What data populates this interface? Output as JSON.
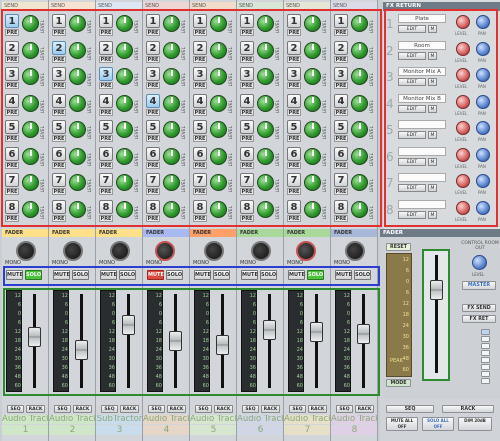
{
  "channels": [
    {
      "header": "SEND",
      "send_sel": 1,
      "mute_on": false,
      "solo_on": true,
      "pan_red": false,
      "name": "Audio Track",
      "num": "1",
      "cap_pos": 0.45
    },
    {
      "header": "SEND",
      "send_sel": 2,
      "mute_on": false,
      "solo_on": false,
      "pan_red": false,
      "name": "Audio Track",
      "num": "2",
      "cap_pos": 0.62
    },
    {
      "header": "SEND",
      "send_sel": 3,
      "mute_on": false,
      "solo_on": false,
      "pan_red": false,
      "name": "SubTractor",
      "num": "3",
      "cap_pos": 0.28
    },
    {
      "header": "SEND",
      "send_sel": 4,
      "mute_on": true,
      "solo_on": false,
      "pan_red": true,
      "name": "Audio Track",
      "num": "4",
      "cap_pos": 0.5
    },
    {
      "header": "SEND",
      "send_sel": 0,
      "mute_on": false,
      "solo_on": false,
      "pan_red": false,
      "name": "Audio Track",
      "num": "5",
      "cap_pos": 0.55
    },
    {
      "header": "SEND",
      "send_sel": 0,
      "mute_on": false,
      "solo_on": false,
      "pan_red": false,
      "name": "Audio Track",
      "num": "6",
      "cap_pos": 0.35
    },
    {
      "header": "SEND",
      "send_sel": 0,
      "mute_on": false,
      "solo_on": true,
      "pan_red": true,
      "name": "Audio Track",
      "num": "7",
      "cap_pos": 0.38
    },
    {
      "header": "SEND",
      "send_sel": 0,
      "mute_on": false,
      "solo_on": false,
      "pan_red": false,
      "name": "Audio Track",
      "num": "8",
      "cap_pos": 0.4
    }
  ],
  "send_labels": [
    "1",
    "2",
    "3",
    "4",
    "5",
    "6",
    "7",
    "8"
  ],
  "pre_label": "PRE",
  "level_label": "LEVEL",
  "fader_label": "FADER",
  "mono_label": "MONO",
  "mute_label": "MUTE",
  "solo_label": "SOLO",
  "seq_label": "SEQ",
  "rack_label": "RACK",
  "meter_ticks": [
    "12",
    "6",
    "0",
    "6",
    "12",
    "18",
    "24",
    "30",
    "36",
    "48",
    "60"
  ],
  "fx_return": {
    "title": "FX RETURN",
    "rows": [
      {
        "num": "1",
        "name": "Plate"
      },
      {
        "num": "2",
        "name": "Room"
      },
      {
        "num": "3",
        "name": "Monitor Mix A"
      },
      {
        "num": "4",
        "name": "Monitor Mix B"
      },
      {
        "num": "5",
        "name": ""
      },
      {
        "num": "6",
        "name": ""
      },
      {
        "num": "7",
        "name": ""
      },
      {
        "num": "8",
        "name": ""
      }
    ],
    "edit_label": "EDIT",
    "m_label": "M",
    "level_label": "LEVEL",
    "pan_label": "PAN"
  },
  "master": {
    "title": "FADER",
    "reset_label": "RESET",
    "control_room_label": "CONTROL ROOM OUT",
    "level_label": "LEVEL",
    "master_label": "MASTER",
    "fx_send_label": "FX SEND",
    "fx_ret_label": "FX RET",
    "peak_label": "PEAK",
    "mode_label": "MODE",
    "cap_pos": 0.25
  },
  "bottom_right": {
    "seq_label": "SEQ",
    "rack_label": "RACK",
    "mute_all": "MUTE ALL OFF",
    "solo_all": "SOLO ALL OFF",
    "dim_label": "DIM 20dB"
  },
  "colors": {
    "highlight_red": "#e03030",
    "highlight_blue": "#2a3ed0",
    "highlight_green": "#2e8a2e",
    "knob_green": "#2f9a2c"
  }
}
